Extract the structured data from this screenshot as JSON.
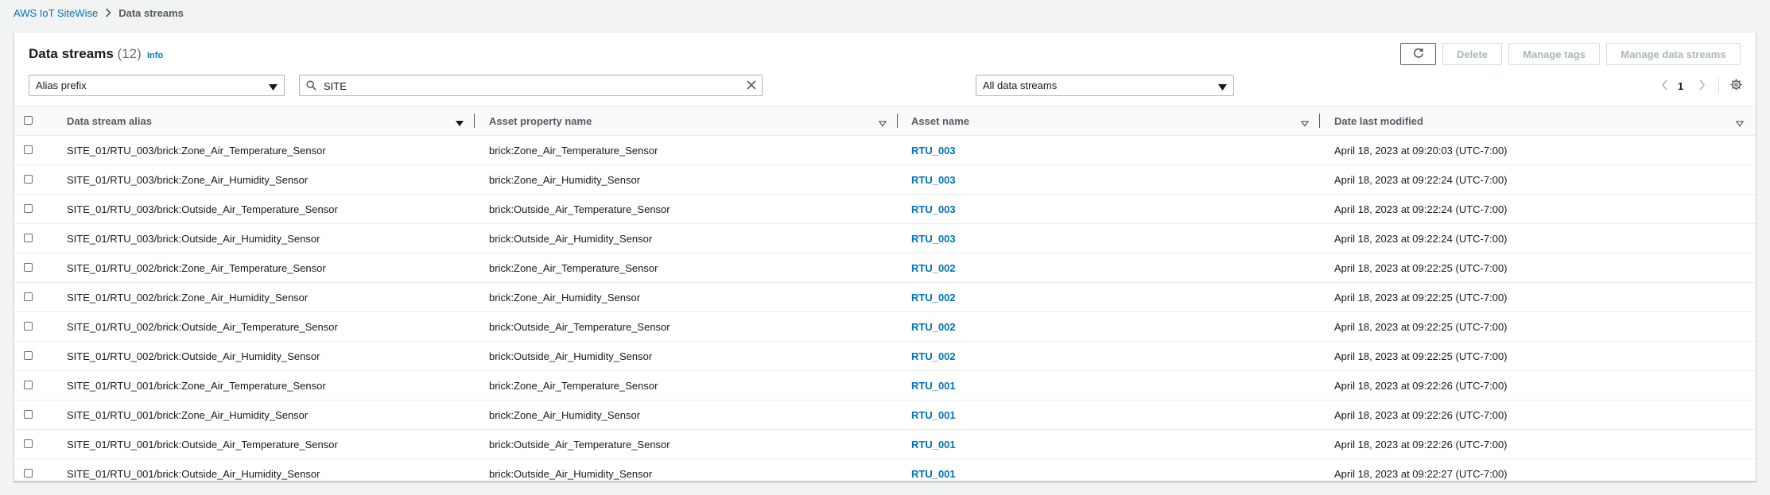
{
  "breadcrumb": {
    "root": "AWS IoT SiteWise",
    "current": "Data streams"
  },
  "header": {
    "title": "Data streams",
    "count": "(12)",
    "info": "Info"
  },
  "actions": {
    "refresh_icon": "refresh-icon",
    "delete": "Delete",
    "manage_tags": "Manage tags",
    "manage_streams": "Manage data streams"
  },
  "filters": {
    "alias_select": "Alias prefix",
    "search_value": "SITE",
    "streams_select": "All data streams"
  },
  "pagination": {
    "page": "1"
  },
  "table": {
    "columns": [
      "Data stream alias",
      "Asset property name",
      "Asset name",
      "Date last modified"
    ],
    "rows": [
      {
        "alias": "SITE_01/RTU_003/brick:Zone_Air_Temperature_Sensor",
        "property": "brick:Zone_Air_Temperature_Sensor",
        "asset": "RTU_003",
        "date": "April 18, 2023 at 09:20:03 (UTC-7:00)"
      },
      {
        "alias": "SITE_01/RTU_003/brick:Zone_Air_Humidity_Sensor",
        "property": "brick:Zone_Air_Humidity_Sensor",
        "asset": "RTU_003",
        "date": "April 18, 2023 at 09:22:24 (UTC-7:00)"
      },
      {
        "alias": "SITE_01/RTU_003/brick:Outside_Air_Temperature_Sensor",
        "property": "brick:Outside_Air_Temperature_Sensor",
        "asset": "RTU_003",
        "date": "April 18, 2023 at 09:22:24 (UTC-7:00)"
      },
      {
        "alias": "SITE_01/RTU_003/brick:Outside_Air_Humidity_Sensor",
        "property": "brick:Outside_Air_Humidity_Sensor",
        "asset": "RTU_003",
        "date": "April 18, 2023 at 09:22:24 (UTC-7:00)"
      },
      {
        "alias": "SITE_01/RTU_002/brick:Zone_Air_Temperature_Sensor",
        "property": "brick:Zone_Air_Temperature_Sensor",
        "asset": "RTU_002",
        "date": "April 18, 2023 at 09:22:25 (UTC-7:00)"
      },
      {
        "alias": "SITE_01/RTU_002/brick:Zone_Air_Humidity_Sensor",
        "property": "brick:Zone_Air_Humidity_Sensor",
        "asset": "RTU_002",
        "date": "April 18, 2023 at 09:22:25 (UTC-7:00)"
      },
      {
        "alias": "SITE_01/RTU_002/brick:Outside_Air_Temperature_Sensor",
        "property": "brick:Outside_Air_Temperature_Sensor",
        "asset": "RTU_002",
        "date": "April 18, 2023 at 09:22:25 (UTC-7:00)"
      },
      {
        "alias": "SITE_01/RTU_002/brick:Outside_Air_Humidity_Sensor",
        "property": "brick:Outside_Air_Humidity_Sensor",
        "asset": "RTU_002",
        "date": "April 18, 2023 at 09:22:25 (UTC-7:00)"
      },
      {
        "alias": "SITE_01/RTU_001/brick:Zone_Air_Temperature_Sensor",
        "property": "brick:Zone_Air_Temperature_Sensor",
        "asset": "RTU_001",
        "date": "April 18, 2023 at 09:22:26 (UTC-7:00)"
      },
      {
        "alias": "SITE_01/RTU_001/brick:Zone_Air_Humidity_Sensor",
        "property": "brick:Zone_Air_Humidity_Sensor",
        "asset": "RTU_001",
        "date": "April 18, 2023 at 09:22:26 (UTC-7:00)"
      },
      {
        "alias": "SITE_01/RTU_001/brick:Outside_Air_Temperature_Sensor",
        "property": "brick:Outside_Air_Temperature_Sensor",
        "asset": "RTU_001",
        "date": "April 18, 2023 at 09:22:26 (UTC-7:00)"
      },
      {
        "alias": "SITE_01/RTU_001/brick:Outside_Air_Humidity_Sensor",
        "property": "brick:Outside_Air_Humidity_Sensor",
        "asset": "RTU_001",
        "date": "April 18, 2023 at 09:22:27 (UTC-7:00)"
      }
    ]
  },
  "colors": {
    "link": "#0073bb",
    "text": "#16191f",
    "muted": "#545b64",
    "border": "#d5dbdb",
    "background": "#f2f3f3"
  }
}
